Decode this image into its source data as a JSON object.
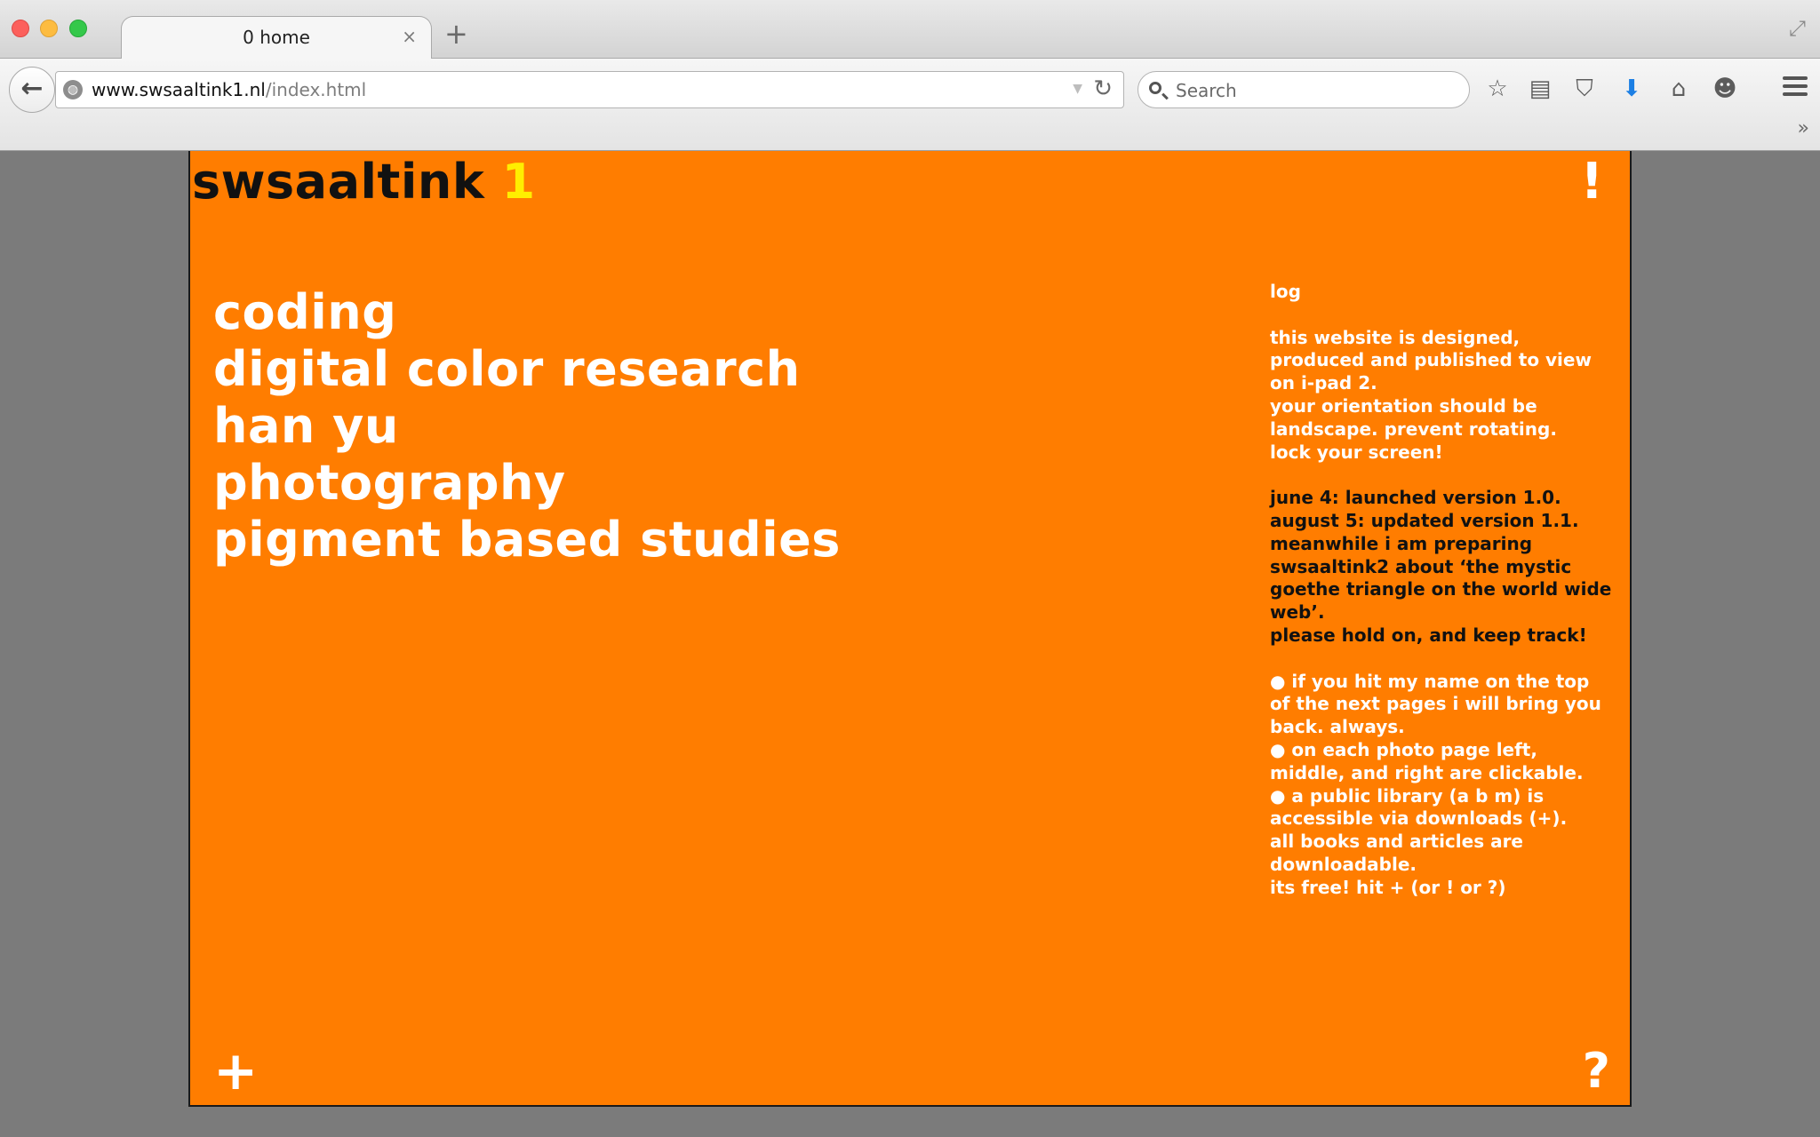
{
  "browser": {
    "tab_title": "0 home",
    "tab_close": "×",
    "new_tab": "+",
    "url_host": "www.swsaaltink1.nl",
    "url_path": "/index.html",
    "search_placeholder": "Search"
  },
  "toolbar": {
    "back": "←",
    "reload": "↻",
    "dropdown": "▼",
    "bookmark": "☆",
    "reading_list": "▤",
    "pocket": "⛉",
    "download": "⬇",
    "home": "⌂",
    "chat": "☻",
    "fullscreen": "⤢",
    "overflow": "»"
  },
  "site": {
    "name": "swsaaltink",
    "number": "1",
    "exclaim": "!",
    "plus": "+",
    "question": "?",
    "menu": [
      "coding",
      "digital color research",
      "han yu",
      "photography",
      "pigment based studies"
    ],
    "log": {
      "heading": "log",
      "intro": [
        "this website is designed,",
        "produced and published to view",
        "on i-pad 2.",
        "your orientation should be",
        "landscape. prevent rotating.",
        "lock your screen!"
      ],
      "versions": [
        "june 4: launched version 1.0.",
        "august 5: updated version 1.1.",
        "meanwhile i am preparing",
        "swsaaltink2 about ‘the mystic",
        "goethe triangle on the world wide",
        "web’.",
        "please hold on, and keep track!"
      ],
      "tips": [
        "● if you hit my name on the top",
        "of the next pages i will bring you",
        "back. always.",
        "● on each photo page left,",
        "middle, and right are clickable.",
        "● a public library (a b m) is",
        "accessible via downloads (+).",
        "all books and articles are",
        "downloadable.",
        "its free! hit + (or ! or ?)"
      ]
    }
  },
  "colors": {
    "page_background": "#ff7d00",
    "title_number": "#ffee00",
    "text_light": "#ffffff",
    "text_dark": "#111111",
    "window_background": "#7b7b7b",
    "download_accent": "#1c7fe4"
  }
}
